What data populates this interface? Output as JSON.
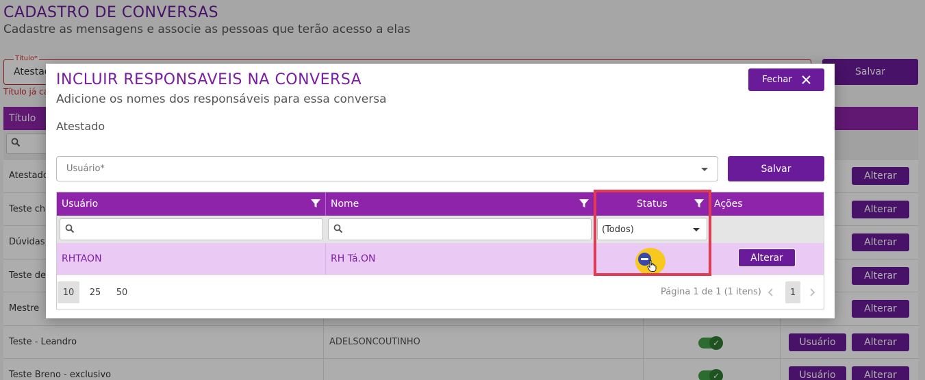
{
  "page": {
    "title": "CADASTRO DE CONVERSAS",
    "subtitle": "Cadastre as mensagens e associe as pessoas que terão acesso a elas",
    "title_field": {
      "label": "Título*",
      "value": "Atestad",
      "error": "Título já cad"
    },
    "save_label": "Salvar",
    "grid": {
      "header": "Título",
      "rows": [
        {
          "title": "Atestado",
          "owner": "",
          "user_btn": "",
          "edit_btn": "Alterar"
        },
        {
          "title": "Teste cha",
          "owner": "",
          "user_btn": "",
          "edit_btn": "Alterar"
        },
        {
          "title": "Dúvidas",
          "owner": "",
          "user_btn": "",
          "edit_btn": "Alterar"
        },
        {
          "title": "Teste des",
          "owner": "",
          "user_btn": "",
          "edit_btn": "Alterar"
        },
        {
          "title": "Mestre",
          "owner": "",
          "user_btn": "",
          "edit_btn": "Alterar"
        },
        {
          "title": "Teste - Leandro",
          "owner": "ADELSONCOUTINHO",
          "user_btn": "Usuário",
          "edit_btn": "Alterar"
        },
        {
          "title": "Teste Breno - exclusivo",
          "owner": "",
          "user_btn": "Usuário",
          "edit_btn": "Alterar"
        }
      ]
    }
  },
  "modal": {
    "title": "INCLUIR RESPONSAVEIS NA CONVERSA",
    "subtitle": "Adicione os nomes dos responsáveis para essa conversa",
    "close_label": "Fechar",
    "conversation_name": "Atestado",
    "user_select": {
      "placeholder": "Usuário*"
    },
    "save_label": "Salvar",
    "grid": {
      "columns": [
        "Usuário",
        "Nome",
        "Status",
        "Ações"
      ],
      "status_filter": "(Todos)",
      "rows": [
        {
          "usuario": "RHTAON",
          "nome": "RH Tá.ON",
          "action": "Alterar"
        }
      ],
      "page_sizes": [
        "10",
        "25",
        "50"
      ],
      "active_page_size": "10",
      "pager_info": "Página 1 de 1 (1 itens)",
      "current_page": "1"
    }
  },
  "colors": {
    "primary": "#6a1b9a",
    "header": "#8e24aa",
    "selected_row": "#ebc9f5",
    "highlight": "#e53950",
    "toggle_on": "#43a047"
  }
}
